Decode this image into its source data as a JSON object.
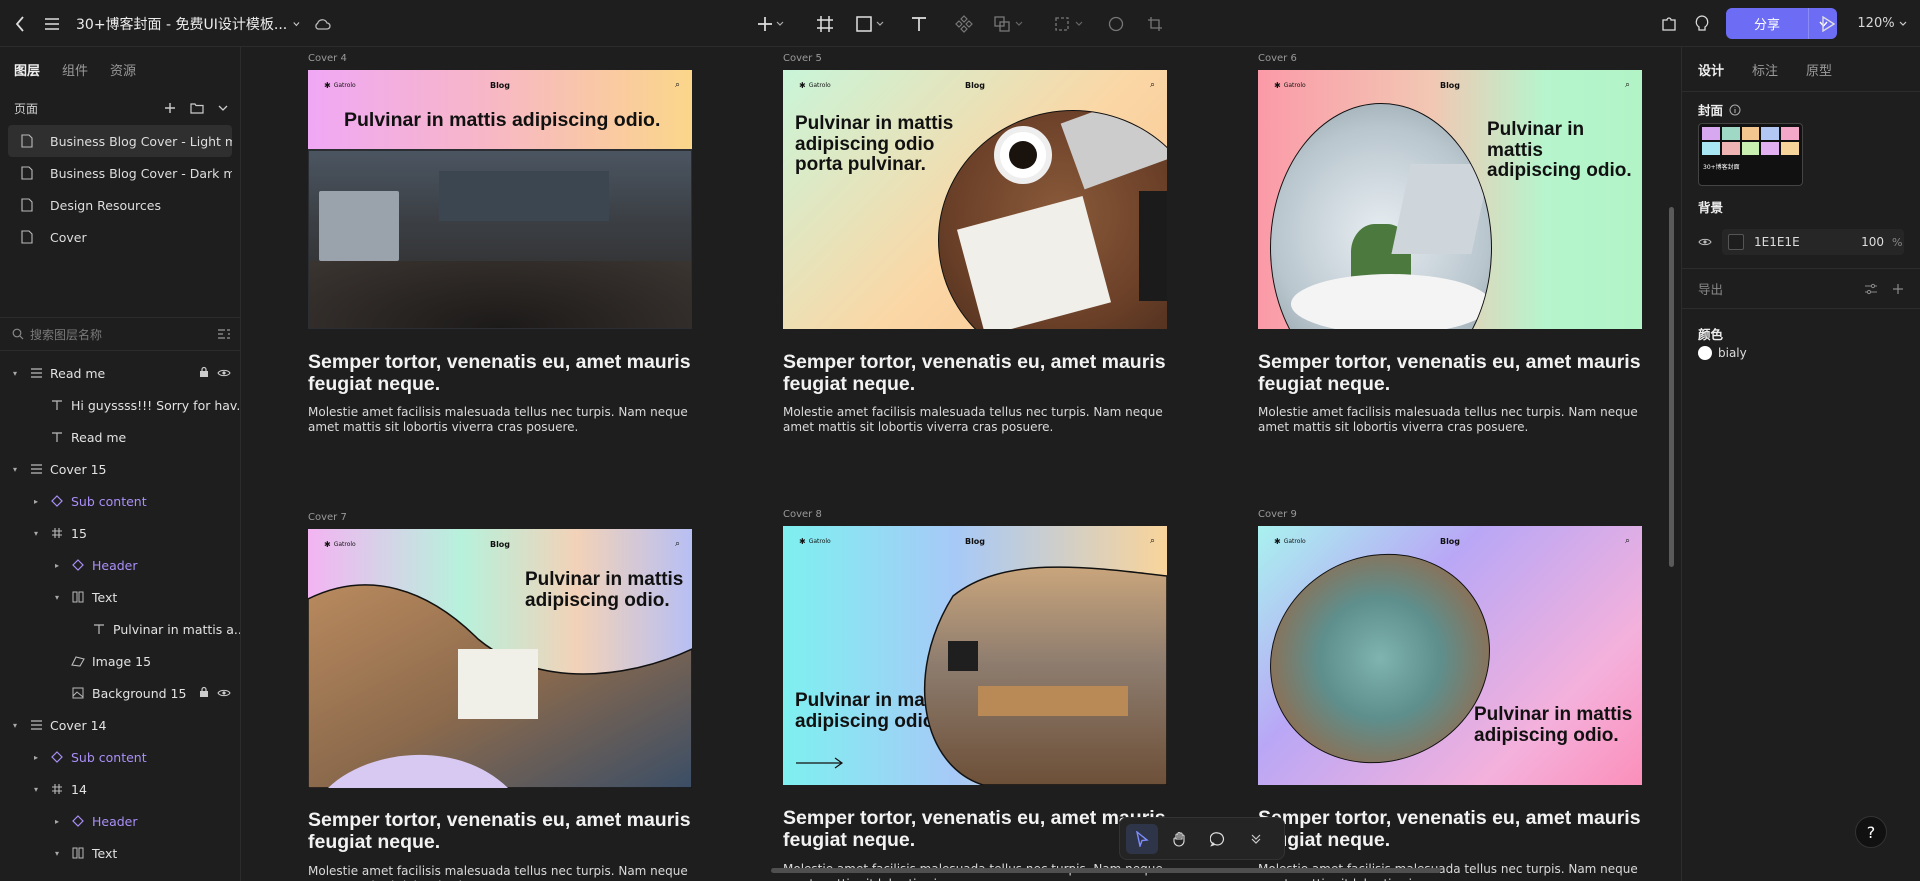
{
  "topbar": {
    "title": "30+博客封面 - 免费UI设计模板...",
    "share_label": "分享",
    "zoom": "120%"
  },
  "left_panel": {
    "tabs": [
      "图层",
      "组件",
      "资源"
    ],
    "pages_label": "页面",
    "pages": [
      "Business Blog Cover - Light mo...",
      "Business Blog Cover - Dark mode",
      "Design Resources",
      "Cover"
    ],
    "search_placeholder": "搜索图层名称",
    "layers": [
      {
        "label": "Read me",
        "indent": 0,
        "arrow": "▾",
        "icon": "frame",
        "comp": false,
        "lock": true,
        "eye": true
      },
      {
        "label": "Hi guyssss!!! Sorry for hav...",
        "indent": 1,
        "arrow": "",
        "icon": "text",
        "comp": false
      },
      {
        "label": "Read me",
        "indent": 1,
        "arrow": "",
        "icon": "text",
        "comp": false
      },
      {
        "label": "Cover 15",
        "indent": 0,
        "arrow": "▾",
        "icon": "frame",
        "comp": false
      },
      {
        "label": "Sub content",
        "indent": 1,
        "arrow": "▸",
        "icon": "component",
        "comp": true
      },
      {
        "label": "15",
        "indent": 1,
        "arrow": "▾",
        "icon": "hash",
        "comp": false
      },
      {
        "label": "Header",
        "indent": 2,
        "arrow": "▸",
        "icon": "component",
        "comp": true
      },
      {
        "label": "Text",
        "indent": 2,
        "arrow": "▾",
        "icon": "columns",
        "comp": false
      },
      {
        "label": "Pulvinar in mattis a...",
        "indent": 3,
        "arrow": "",
        "icon": "text",
        "comp": false
      },
      {
        "label": "Image 15",
        "indent": 2,
        "arrow": "",
        "icon": "image",
        "comp": false
      },
      {
        "label": "Background 15",
        "indent": 2,
        "arrow": "",
        "icon": "bgimage",
        "comp": false,
        "lock": true,
        "eye": true
      },
      {
        "label": "Cover 14",
        "indent": 0,
        "arrow": "▾",
        "icon": "frame",
        "comp": false
      },
      {
        "label": "Sub content",
        "indent": 1,
        "arrow": "▸",
        "icon": "component",
        "comp": true
      },
      {
        "label": "14",
        "indent": 1,
        "arrow": "▾",
        "icon": "hash",
        "comp": false
      },
      {
        "label": "Header",
        "indent": 2,
        "arrow": "▸",
        "icon": "component",
        "comp": true
      },
      {
        "label": "Text",
        "indent": 2,
        "arrow": "▾",
        "icon": "columns",
        "comp": false
      }
    ]
  },
  "canvas": {
    "nav_blog": "Blog",
    "nav_logo": "Gatrolo",
    "card_title": "Semper tortor, venenatis eu, amet mauris feugiat neque.",
    "card_desc": "Molestie amet facilisis malesuada tellus nec turpis. Nam neque amet mattis sit lobortis viverra cras posuere.",
    "covers": [
      {
        "label": "Cover 4",
        "headline": "Pulvinar in mattis adipiscing odio."
      },
      {
        "label": "Cover 5",
        "headline": "Pulvinar in mattis adipiscing odio porta pulvinar."
      },
      {
        "label": "Cover 6",
        "headline": "Pulvinar in mattis adipiscing odio."
      },
      {
        "label": "Cover 7",
        "headline": "Pulvinar in mattis adipiscing odio."
      },
      {
        "label": "Cover 8",
        "headline": "Pulvinar in mattis adipiscing odio."
      },
      {
        "label": "Cover 9",
        "headline": "Pulvinar in mattis adipiscing odio."
      }
    ]
  },
  "right_panel": {
    "tabs": [
      "设计",
      "标注",
      "原型"
    ],
    "cover_label": "封面",
    "thumb_text": "30+博客封面",
    "background_label": "背景",
    "bg_hex": "1E1E1E",
    "bg_opacity": "100",
    "bg_unit": "%",
    "export_label": "导出",
    "colors_label": "颜色",
    "color_name": "bialy"
  },
  "colors": {
    "accent": "#6c6cf5",
    "component": "#a98ff7",
    "panel_bg": "#1e1e1e"
  }
}
